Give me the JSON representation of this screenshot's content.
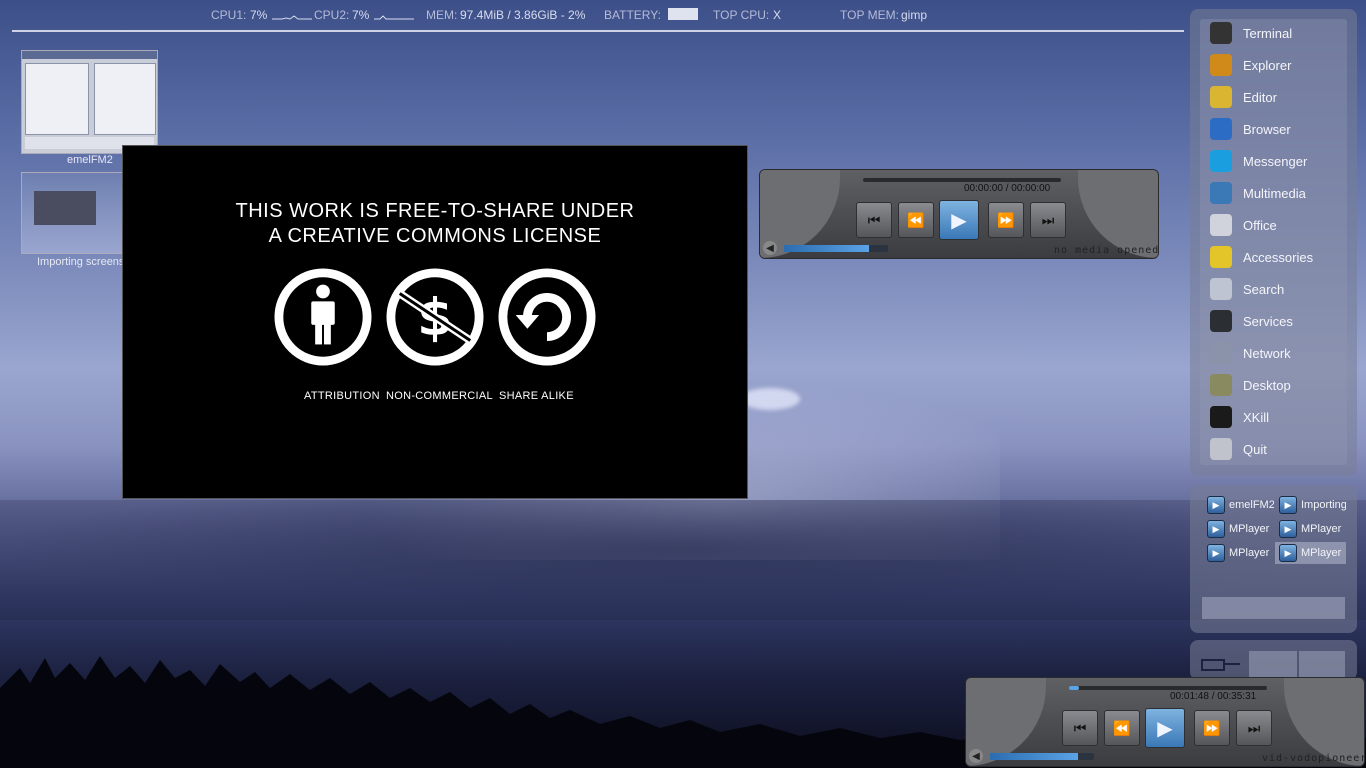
{
  "conky": {
    "cpu1_label": "CPU1:",
    "cpu1_value": "7%",
    "cpu2_label": "CPU2:",
    "cpu2_value": "7%",
    "mem_label": "MEM:",
    "mem_value": "97.4MiB / 3.86GiB - 2%",
    "battery_label": "BATTERY:",
    "top_cpu_label": "TOP CPU:",
    "top_cpu_value": "X",
    "top_mem_label": "TOP MEM:",
    "top_mem_value": "gimp"
  },
  "desktop": {
    "thumb1_label": "emelFM2",
    "thumb2_label": "Importing screens"
  },
  "cc_window": {
    "title_line1": "THIS WORK IS FREE-TO-SHARE UNDER",
    "title_line2": "A CREATIVE COMMONS LICENSE",
    "caption_attribution": "ATTRIBUTION",
    "caption_noncommercial": "NON-COMMERCIAL",
    "caption_sharealike": "SHARE ALIKE"
  },
  "player_top": {
    "time": "00:00:00 / 00:00:00",
    "status": "no media opened.",
    "volume_fraction": 0.82
  },
  "player_bottom": {
    "time": "00:01:48 / 00:35:31",
    "status": "vid-vodopioneer.on",
    "progress_fraction": 0.05,
    "volume_fraction": 0.85
  },
  "menu": {
    "items": [
      {
        "label": "Terminal",
        "icon": "terminal-icon",
        "color": "#333333"
      },
      {
        "label": "Explorer",
        "icon": "explorer-icon",
        "color": "#d08a1a"
      },
      {
        "label": "Editor",
        "icon": "editor-icon",
        "color": "#d9b531"
      },
      {
        "label": "Browser",
        "icon": "browser-icon",
        "color": "#2c6cc4"
      },
      {
        "label": "Messenger",
        "icon": "messenger-icon",
        "color": "#1a9ee0"
      },
      {
        "label": "Multimedia",
        "icon": "multimedia-icon",
        "color": "#3a78b6"
      },
      {
        "label": "Office",
        "icon": "office-icon",
        "color": "#d0d3dc"
      },
      {
        "label": "Accessories",
        "icon": "accessories-icon",
        "color": "#e3c52a"
      },
      {
        "label": "Search",
        "icon": "search-icon",
        "color": "#bfc4d2"
      },
      {
        "label": "Services",
        "icon": "services-icon",
        "color": "#2b2f33"
      },
      {
        "label": "Network",
        "icon": "network-icon",
        "color": "#8a93aa"
      },
      {
        "label": "Desktop",
        "icon": "desktop-icon",
        "color": "#8a8a60"
      },
      {
        "label": "XKill",
        "icon": "skull-icon",
        "color": "#1a1a1a"
      },
      {
        "label": "Quit",
        "icon": "power-icon",
        "color": "#c0c3cc"
      }
    ]
  },
  "tasks": {
    "items": [
      {
        "label": "emelFM2",
        "icon": "emelfm2-icon"
      },
      {
        "label": "Importing",
        "icon": "importing-icon"
      },
      {
        "label": "MPlayer",
        "icon": "mplayer-icon"
      },
      {
        "label": "MPlayer",
        "icon": "mplayer-icon"
      },
      {
        "label": "MPlayer",
        "icon": "mplayer-icon"
      },
      {
        "label": "MPlayer",
        "icon": "mplayer-icon"
      }
    ]
  }
}
